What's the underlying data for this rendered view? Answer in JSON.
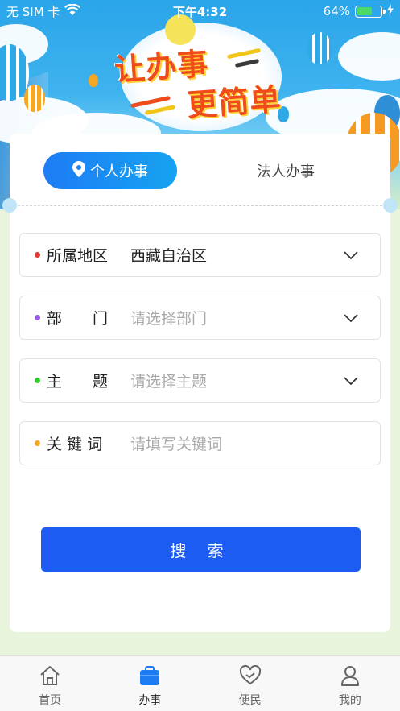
{
  "status_bar": {
    "carrier": "无 SIM 卡",
    "time": "下午4:32",
    "battery_percent": "64%",
    "battery_level": 0.64
  },
  "banner": {
    "line1": "让办事",
    "line2": "更简单"
  },
  "tabs": {
    "active": "个人办事",
    "inactive": "法人办事"
  },
  "form": {
    "fields": [
      {
        "label": "所属地区",
        "value": "西藏自治区",
        "placeholder": "",
        "dot_color": "#e53935",
        "has_dropdown": true
      },
      {
        "label": "部　　门",
        "value": "",
        "placeholder": "请选择部门",
        "dot_color": "#9c5ce6",
        "has_dropdown": true
      },
      {
        "label": "主　　题",
        "value": "",
        "placeholder": "请选择主题",
        "dot_color": "#2ecc2e",
        "has_dropdown": true
      },
      {
        "label": "关 键 词",
        "value": "",
        "placeholder": "请填写关键词",
        "dot_color": "#f5a623",
        "has_dropdown": false
      }
    ],
    "search_label": "搜 索"
  },
  "tabbar": {
    "items": [
      {
        "label": "首页",
        "icon": "home-icon",
        "active": false
      },
      {
        "label": "办事",
        "icon": "briefcase-icon",
        "active": true
      },
      {
        "label": "便民",
        "icon": "heart-icon",
        "active": false
      },
      {
        "label": "我的",
        "icon": "user-icon",
        "active": false
      }
    ]
  },
  "colors": {
    "primary": "#1d5cf2",
    "tab_gradient_start": "#1e7cf5",
    "tab_gradient_end": "#16a3f0",
    "banner_title": "#f04b1a"
  }
}
